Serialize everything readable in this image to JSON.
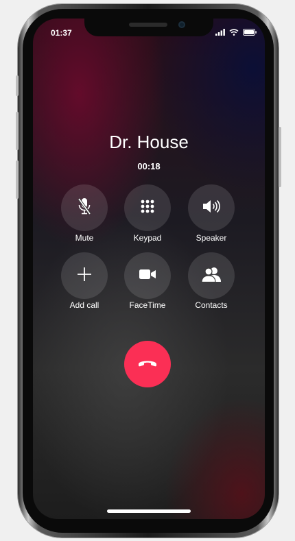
{
  "status_bar": {
    "time": "01:37",
    "icons": [
      "signal-icon",
      "wifi-icon",
      "battery-icon"
    ]
  },
  "call": {
    "caller_name": "Dr. House",
    "duration": "00:18"
  },
  "buttons": [
    {
      "label": "Mute",
      "icon": "microphone-off-icon"
    },
    {
      "label": "Keypad",
      "icon": "keypad-icon"
    },
    {
      "label": "Speaker",
      "icon": "speaker-icon"
    },
    {
      "label": "Add call",
      "icon": "plus-icon"
    },
    {
      "label": "FaceTime",
      "icon": "video-camera-icon"
    },
    {
      "label": "Contacts",
      "icon": "contacts-icon"
    }
  ],
  "end_call": {
    "icon": "hang-up-icon"
  },
  "colors": {
    "end_call": "#fb2f55",
    "button_bg": "rgba(255,255,255,0.12)",
    "text": "#ffffff"
  }
}
